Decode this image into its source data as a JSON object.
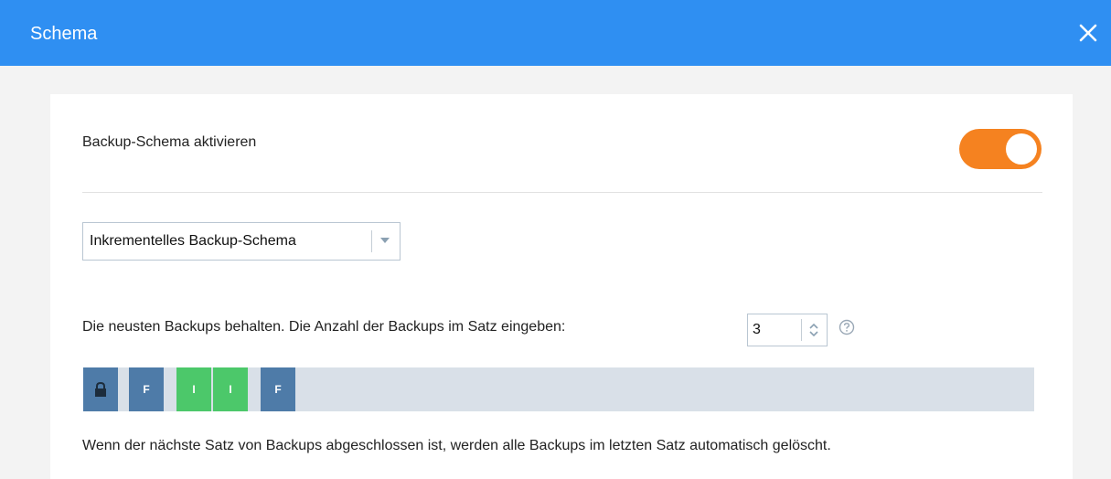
{
  "window": {
    "title": "Schema",
    "close_icon": "close-icon"
  },
  "scheme_toggle": {
    "label": "Backup-Schema aktivieren",
    "enabled": true,
    "color": "#f58220"
  },
  "scheme_select": {
    "value": "Inkrementelles Backup-Schema"
  },
  "keep": {
    "label": "Die neusten Backups behalten. Die Anzahl der Backups im Satz eingeben:",
    "value": "3",
    "help_icon": "question-circle-icon"
  },
  "backup_strip": {
    "lock_icon": "lock-icon",
    "cells": [
      {
        "type": "full",
        "label": "F"
      },
      {
        "type": "inc",
        "label": "I"
      },
      {
        "type": "inc",
        "label": "I"
      },
      {
        "type": "full",
        "label": "F"
      }
    ],
    "colors": {
      "full": "#4e7ba8",
      "inc": "#4cc86a",
      "track": "#d9e0e8"
    }
  },
  "note": "Wenn der nächste Satz von Backups abgeschlossen ist, werden alle Backups im letzten Satz automatisch gelöscht."
}
